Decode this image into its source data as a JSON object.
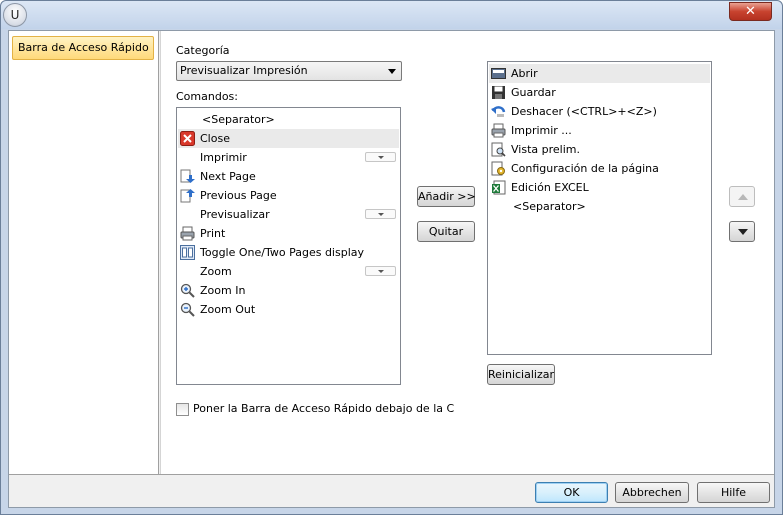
{
  "window": {
    "app_icon_letter": "U",
    "close_symbol": "✕"
  },
  "nav": {
    "items": [
      {
        "label": "Barra de Acceso Rápido",
        "selected": true
      }
    ]
  },
  "category": {
    "label": "Categoría",
    "selected": "Previsualizar Impresión"
  },
  "commands": {
    "label": "Comandos:",
    "items": [
      {
        "label": "<Separator>",
        "icon": "none",
        "has_dropdown": false
      },
      {
        "label": "Close",
        "icon": "close-red-icon",
        "has_dropdown": false,
        "selected": true
      },
      {
        "label": "Imprimir",
        "icon": "none",
        "has_dropdown": true
      },
      {
        "label": "Next Page",
        "icon": "next-page-icon",
        "has_dropdown": false
      },
      {
        "label": "Previous Page",
        "icon": "previous-page-icon",
        "has_dropdown": false
      },
      {
        "label": "Previsualizar",
        "icon": "none",
        "has_dropdown": true
      },
      {
        "label": "Print",
        "icon": "printer-icon",
        "has_dropdown": false
      },
      {
        "label": "Toggle One/Two Pages display",
        "icon": "two-pages-icon",
        "has_dropdown": false
      },
      {
        "label": "Zoom",
        "icon": "none",
        "has_dropdown": true
      },
      {
        "label": "Zoom In",
        "icon": "zoom-in-icon",
        "has_dropdown": false
      },
      {
        "label": "Zoom Out",
        "icon": "zoom-out-icon",
        "has_dropdown": false
      }
    ]
  },
  "actions": {
    "add_label": "Añadir >>",
    "remove_label": "Quitar"
  },
  "toolbar_items": {
    "items": [
      {
        "label": "Abrir",
        "icon": "folder-open-icon",
        "selected": true
      },
      {
        "label": "Guardar",
        "icon": "floppy-disk-icon"
      },
      {
        "label": "Deshacer (<CTRL>+<Z>)",
        "icon": "undo-icon"
      },
      {
        "label": "Imprimir ...",
        "icon": "printer-icon"
      },
      {
        "label": "Vista prelim.",
        "icon": "print-preview-icon"
      },
      {
        "label": "Configuración de la página",
        "icon": "page-setup-icon"
      },
      {
        "label": "Edición EXCEL",
        "icon": "excel-icon"
      },
      {
        "label": "<Separator>",
        "icon": "none"
      }
    ]
  },
  "reset_label": "Reinicializar",
  "below_ribbon_label": "Poner la Barra de Acceso Rápido debajo de la C",
  "footer": {
    "ok_label": "OK",
    "cancel_label": "Abbrechen",
    "help_label": "Hilfe"
  }
}
